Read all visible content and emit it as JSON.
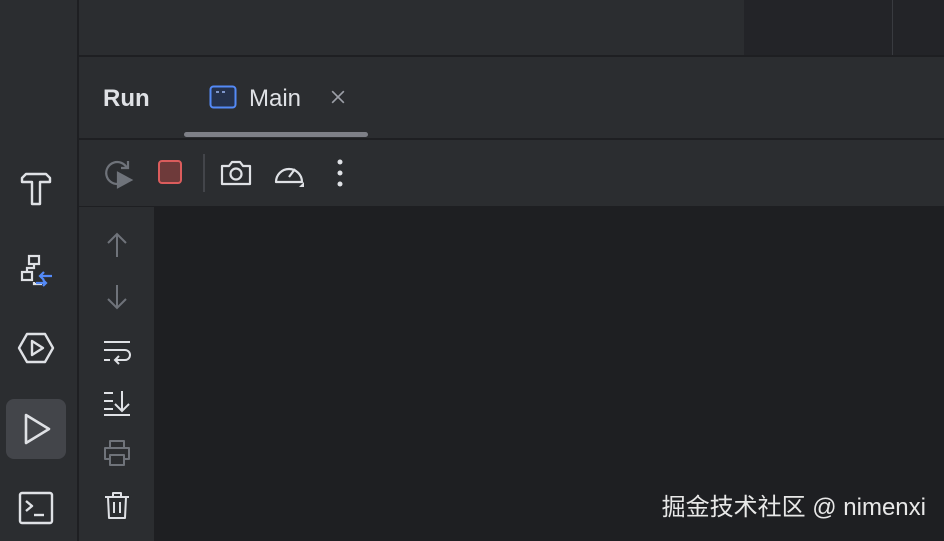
{
  "run_window": {
    "title": "Run",
    "tab": {
      "label": "Main",
      "icon": "application-window-icon"
    }
  },
  "left_stripe": {
    "items": [
      {
        "icon": "hammer-icon",
        "name": "build"
      },
      {
        "icon": "structure-arrow-icon",
        "name": "structure"
      },
      {
        "icon": "hexagon-play-icon",
        "name": "services"
      },
      {
        "icon": "play-icon",
        "name": "run",
        "active": true
      },
      {
        "icon": "terminal-icon",
        "name": "terminal"
      }
    ]
  },
  "toolbar": {
    "buttons": [
      "rerun-icon",
      "stop-icon",
      "camera-icon",
      "gauge-icon",
      "more-vertical-icon"
    ]
  },
  "side_actions": {
    "buttons": [
      "arrow-up-icon",
      "arrow-down-icon",
      "soft-wrap-icon",
      "scroll-to-end-icon",
      "print-icon",
      "trash-icon"
    ]
  },
  "colors": {
    "accent_blue": "#548af7",
    "stop_red": "#db5c5c",
    "background": "#1e1f22",
    "panel": "#2b2d30"
  },
  "watermark": "掘金技术社区 @ nimenxi"
}
